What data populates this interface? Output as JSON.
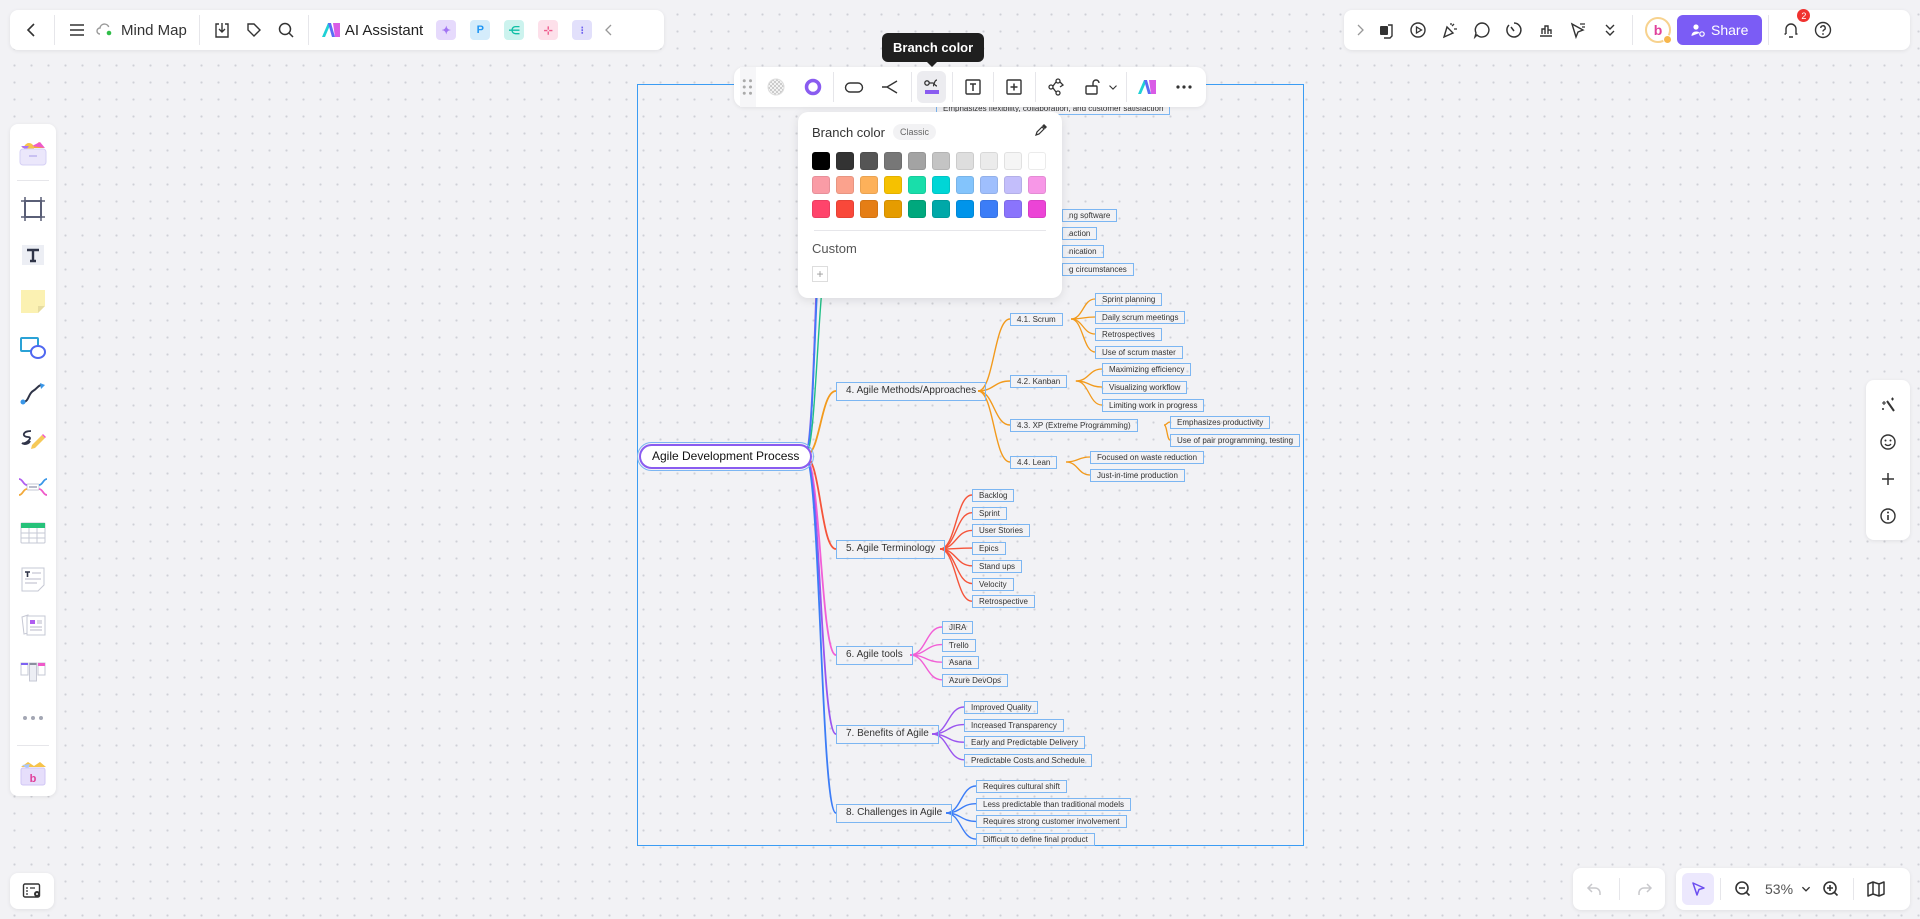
{
  "topbar_left": {
    "back_icon": "chevron-left-icon",
    "menu_icon": "hamburger-icon",
    "title": "Mind Map",
    "ai_assistant_label": "AI Assistant",
    "apps": [
      {
        "name": "image-gen-app",
        "glyph": "✦",
        "bg": "#e6dafc",
        "fg": "#a274f3"
      },
      {
        "name": "presentation-app",
        "glyph": "P",
        "bg": "#d4ecfb",
        "fg": "#2196f3"
      },
      {
        "name": "mindmap-app",
        "glyph": "⋲",
        "bg": "#ccf3ee",
        "fg": "#10bfa5"
      },
      {
        "name": "flowchart-app",
        "glyph": "⊹",
        "bg": "#fde0ea",
        "fg": "#ef5a8c"
      },
      {
        "name": "chat-app",
        "glyph": "⁝",
        "bg": "#e2e0fb",
        "fg": "#6e62f0"
      }
    ]
  },
  "topbar_right": {
    "share_label": "Share",
    "notification_count": "2",
    "avatar_letter": "b"
  },
  "tooltip": "Branch color",
  "color_popover": {
    "title": "Branch color",
    "theme_chip": "Classic",
    "custom_label": "Custom",
    "add_label": "+",
    "swatches": [
      "#000000",
      "#333333",
      "#555555",
      "#777777",
      "#a3a3a3",
      "#c4c4c4",
      "#dedede",
      "#ebebeb",
      "#f5f5f5",
      "#ffffff",
      "#fa9ca6",
      "#fba28d",
      "#fdb15a",
      "#f6c100",
      "#19deaa",
      "#00d6d6",
      "#83c4fc",
      "#9fbffd",
      "#c3befb",
      "#f797e7",
      "#ff446b",
      "#f9483a",
      "#e57e15",
      "#e59c00",
      "#00a87d",
      "#00a8a8",
      "#0094ea",
      "#3c7df7",
      "#8a74fc",
      "#ec44d6"
    ]
  },
  "zoom": {
    "value": "53%"
  },
  "mindmap": {
    "root": "Agile Development Process",
    "top_partial": [
      {
        "text": "Emphasizes flexibility, collaboration, and customer satisfaction"
      },
      {
        "text": "ng software"
      },
      {
        "text": "action"
      },
      {
        "text": "nication"
      },
      {
        "text": "g circumstances"
      }
    ],
    "branches": [
      {
        "label": "4. Agile Methods/Approaches",
        "color": "#f29a1c",
        "children": [
          {
            "label": "4.1. Scrum",
            "children": [
              "Sprint planning",
              "Daily scrum meetings",
              "Retrospectives",
              "Use of scrum master"
            ]
          },
          {
            "label": "4.2. Kanban",
            "children": [
              "Maximizing efficiency",
              "Visualizing workflow",
              "Limiting work in progress"
            ]
          },
          {
            "label": "4.3. XP (Extreme Programming)",
            "children": [
              "Emphasizes productivity",
              "Use of pair programming, testing"
            ]
          },
          {
            "label": "4.4. Lean",
            "children": [
              "Focused on waste reduction",
              "Just-in-time production"
            ]
          }
        ]
      },
      {
        "label": "5. Agile Terminology",
        "color": "#f5543a",
        "children": [
          "Backlog",
          "Sprint",
          "User Stories",
          "Epics",
          "Stand ups",
          "Velocity",
          "Retrospective"
        ]
      },
      {
        "label": "6. Agile tools",
        "color": "#f25fd6",
        "children": [
          "JIRA",
          "Trello",
          "Asana",
          "Azure DevOps"
        ]
      },
      {
        "label": "7. Benefits of Agile",
        "color": "#9a55ef",
        "children": [
          "Improved Quality",
          "Increased Transparency",
          "Early and Predictable Delivery",
          "Predictable Costs and Schedule"
        ]
      },
      {
        "label": "8. Challenges in Agile",
        "color": "#3c7df7",
        "children": [
          "Requires cultural shift",
          "Less predictable than traditional models",
          "Requires strong customer involvement",
          "Difficult to define final product"
        ]
      }
    ]
  }
}
